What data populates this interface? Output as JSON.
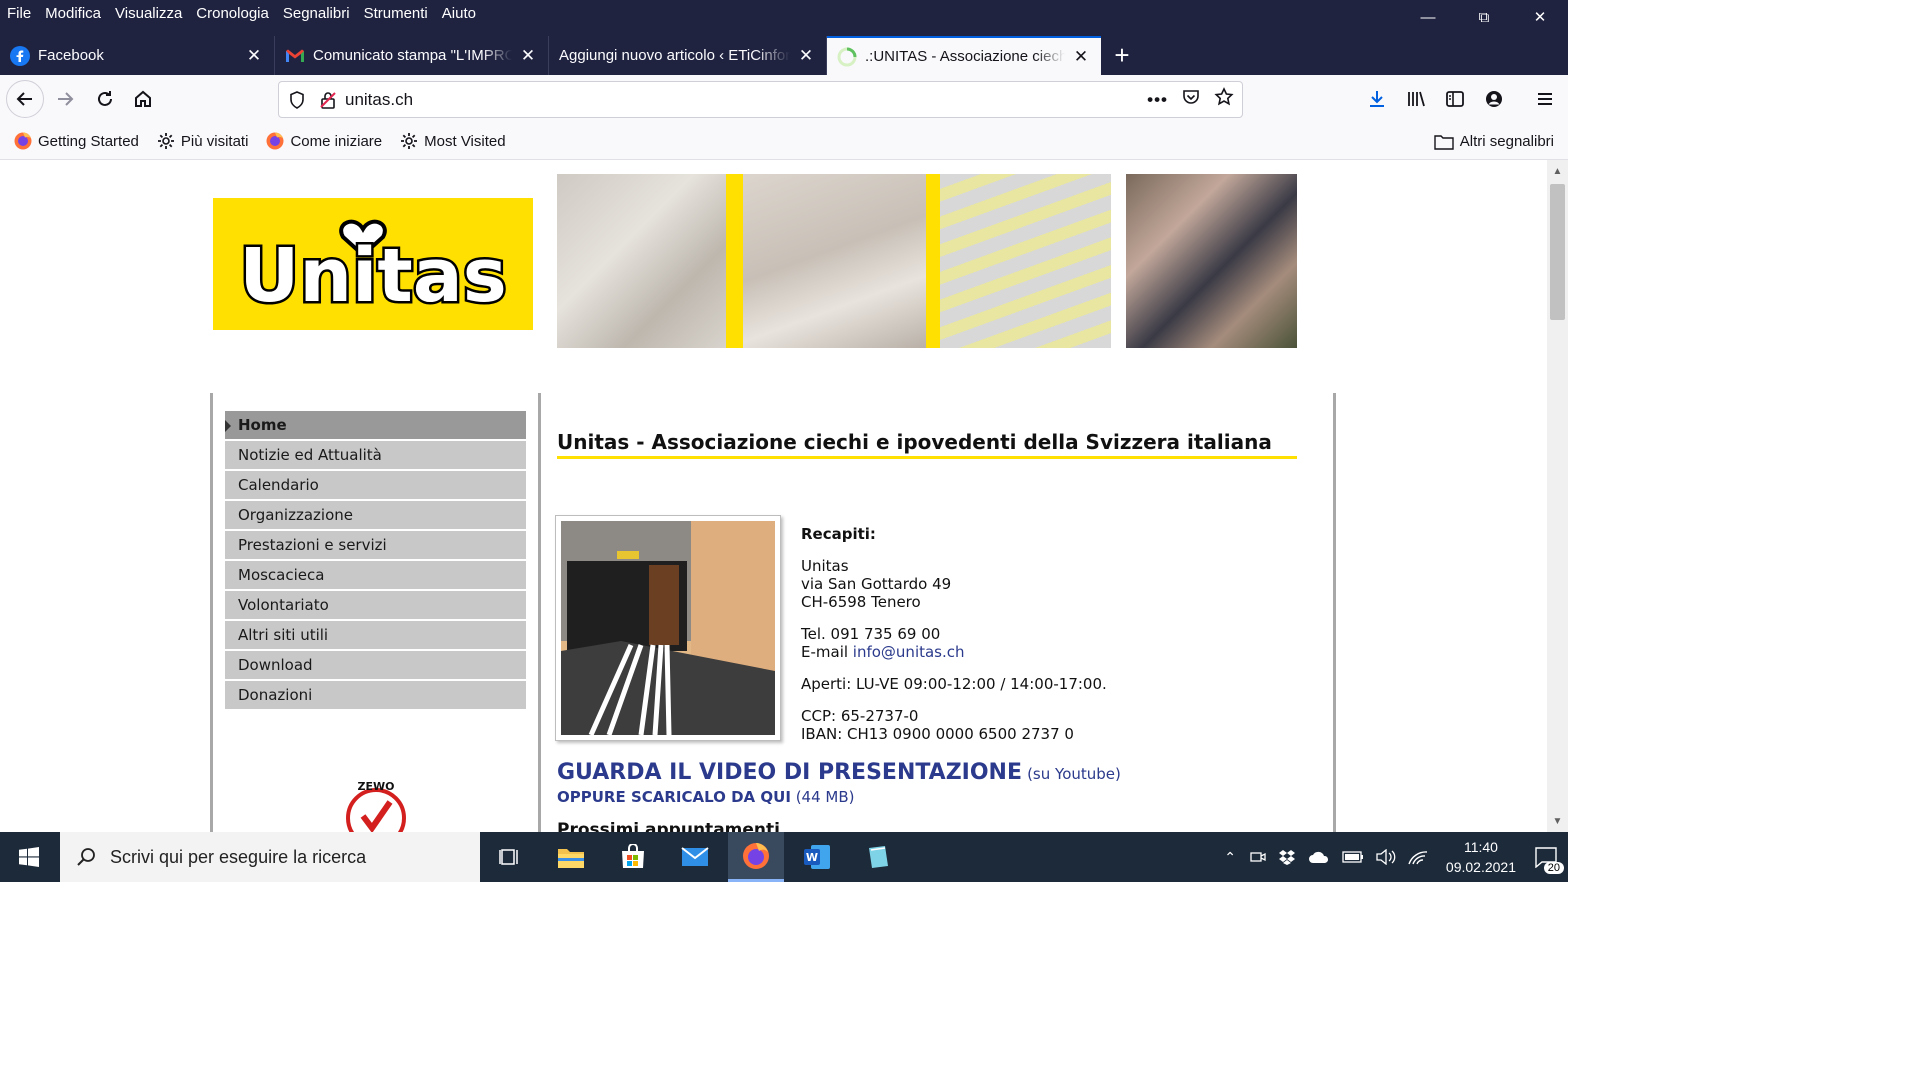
{
  "menubar": {
    "items": [
      "File",
      "Modifica",
      "Visualizza",
      "Cronologia",
      "Segnalibri",
      "Strumenti",
      "Aiuto"
    ]
  },
  "tabs": [
    {
      "title": "Facebook",
      "icon": "facebook-icon"
    },
    {
      "title": "Comunicato stampa \"L'IMPRONTA\"",
      "icon": "gmail-icon"
    },
    {
      "title": "Aggiungi nuovo articolo ‹ ETiCinforma",
      "icon": "wordpress-icon"
    },
    {
      "title": ".:UNITAS - Associazione ciechi e ipovedenti",
      "icon": "loading-icon"
    }
  ],
  "urlbar": {
    "url": "unitas.ch"
  },
  "bookmarks": {
    "items": [
      {
        "label": "Getting Started",
        "icon": "firefox-icon"
      },
      {
        "label": "Più visitati",
        "icon": "gear-icon"
      },
      {
        "label": "Come iniziare",
        "icon": "firefox-icon"
      },
      {
        "label": "Most Visited",
        "icon": "gear-icon"
      }
    ],
    "other": "Altri segnalibri"
  },
  "site": {
    "logo_text": "Unitas",
    "brand_color": "#ffe000",
    "menu": [
      "Home",
      "Notizie ed Attualità",
      "Calendario",
      "Organizzazione",
      "Prestazioni e servizi",
      "Moscacieca",
      "Volontariato",
      "Altri siti utili",
      "Download",
      "Donazioni"
    ],
    "title": "Unitas - Associazione ciechi e ipovedenti della Svizzera italiana",
    "contacts": {
      "heading": "Recapiti:",
      "name": "Unitas",
      "street": "via San Gottardo 49",
      "city": "CH-6598 Tenero",
      "tel": "Tel. 091 735 69 00",
      "email_label": "E-mail ",
      "email": "info@unitas.ch",
      "hours": "Aperti: LU-VE 09:00-12:00 / 14:00-17:00.",
      "ccp": "CCP: 65-2737-0",
      "iban": "IBAN: CH13 0900 0000 6500 2737 0"
    },
    "video_title": "GUARDA IL VIDEO DI PRESENTAZIONE",
    "video_link": "(su Youtube)",
    "download_title": "OPPURE SCARICALO DA QUI",
    "download_size": "(44 MB)",
    "next_heading": "Prossimi appuntamenti",
    "zewo_text": "ZEWO"
  },
  "taskbar": {
    "search_placeholder": "Scrivi qui per eseguire la ricerca",
    "time": "11:40",
    "date": "09.02.2021",
    "notifications": "20"
  }
}
